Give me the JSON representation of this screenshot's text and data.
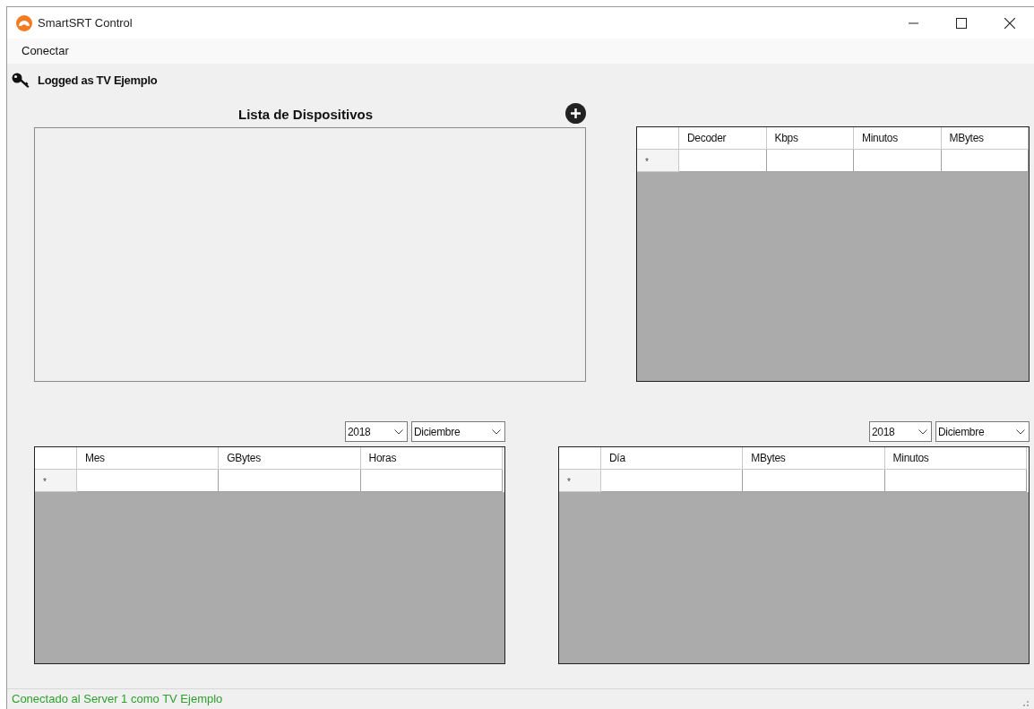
{
  "window": {
    "title": "SmartSRT Control"
  },
  "menu": [
    "Conectar"
  ],
  "login": {
    "label": "Logged as TV Ejemplo"
  },
  "device_list": {
    "title": "Lista de Dispositivos"
  },
  "decoder_table": {
    "columns": [
      "Decoder",
      "Kbps",
      "Minutos",
      "MBytes"
    ],
    "new_row_marker": "*"
  },
  "monthly": {
    "year": "2018",
    "month": "Diciembre",
    "table": {
      "columns": [
        "Mes",
        "GBytes",
        "Horas"
      ],
      "new_row_marker": "*"
    }
  },
  "daily": {
    "year": "2018",
    "month": "Diciembre",
    "table": {
      "columns": [
        "Día",
        "MBytes",
        "Minutos"
      ],
      "new_row_marker": "*"
    }
  },
  "status_bar": {
    "text": "Conectado al Server 1 como TV Ejemplo"
  }
}
